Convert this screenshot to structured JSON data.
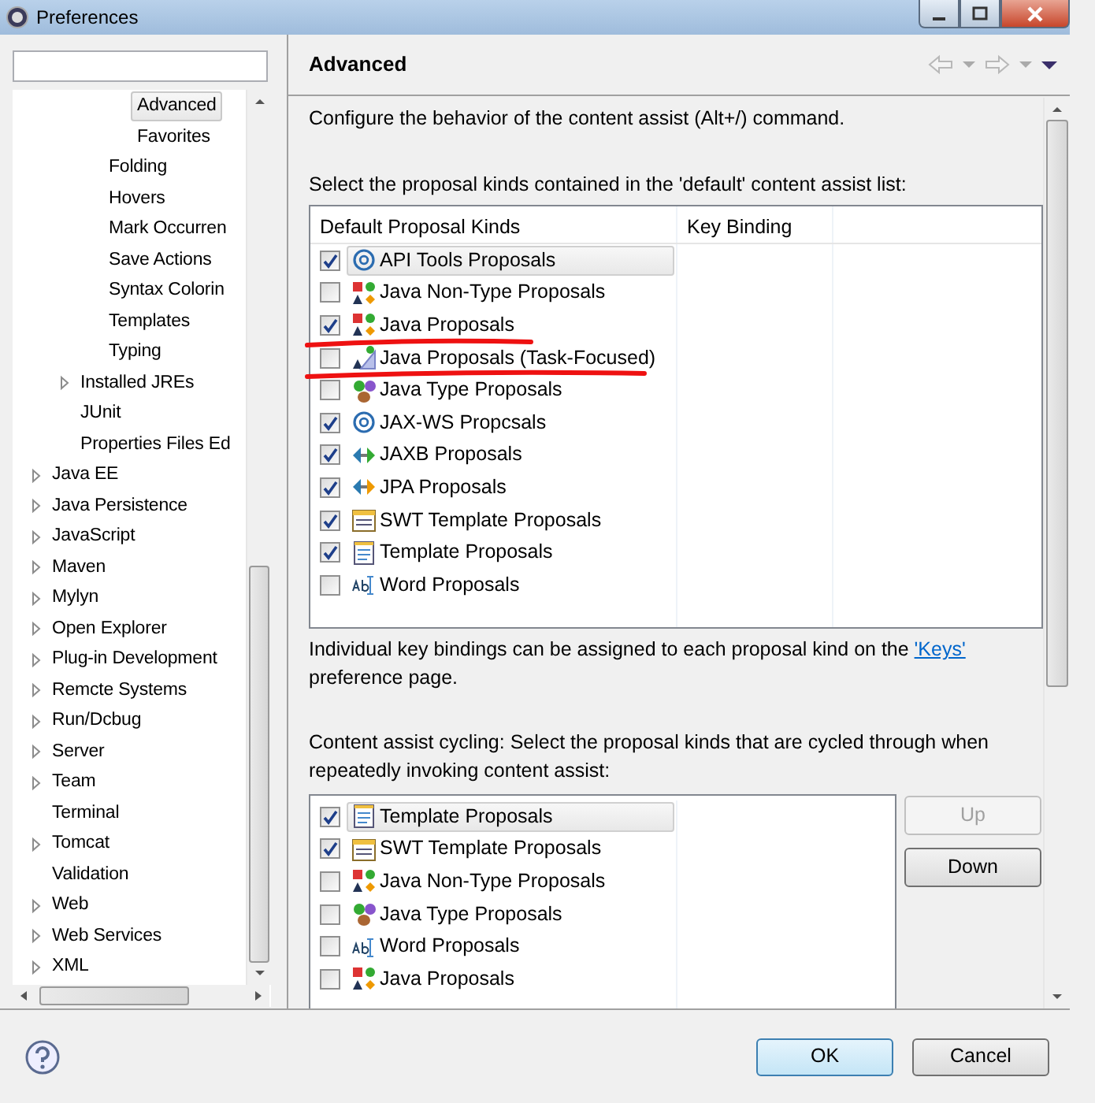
{
  "window": {
    "title": "Preferences"
  },
  "tree": [
    {
      "children": [
        {
          "children": [
            {
              "children": [
                {
                  "label": "Advanced",
                  "selected": true
                },
                {
                  "label": "Favorites",
                  "selected": false
                }
              ]
            },
            {
              "label": "Folding",
              "selected": false
            },
            {
              "label": "Hovers",
              "selected": false
            },
            {
              "label": "Mark Occurren",
              "selected": false
            },
            {
              "label": "Save Actions",
              "selected": false
            },
            {
              "label": "Syntax Colorin",
              "selected": false
            },
            {
              "label": "Templates",
              "selected": false
            },
            {
              "label": "Typing",
              "selected": false
            }
          ]
        },
        {
          "label": "Installed JREs",
          "selected": false,
          "expanded": false
        },
        {
          "label": "JUnit",
          "selected": false
        },
        {
          "label": "Properties Files Ed",
          "selected": false
        }
      ]
    },
    {
      "label": "Java EE",
      "selected": false,
      "expanded": false
    },
    {
      "label": "Java Persistence",
      "selected": false,
      "expanded": false
    },
    {
      "label": "JavaScript",
      "selected": false,
      "expanded": false
    },
    {
      "label": "Maven",
      "selected": false,
      "expanded": false
    },
    {
      "label": "Mylyn",
      "selected": false,
      "expanded": false
    },
    {
      "label": "Open Explorer",
      "selected": false,
      "expanded": false
    },
    {
      "label": "Plug-in Development",
      "selected": false,
      "expanded": false
    },
    {
      "label": "Remcte Systems",
      "selected": false,
      "expanded": false
    },
    {
      "label": "Run/Dcbug",
      "selected": false,
      "expanded": false
    },
    {
      "label": "Server",
      "selected": false,
      "expanded": false
    },
    {
      "label": "Team",
      "selected": false,
      "expanded": false
    },
    {
      "label": "Terminal",
      "selected": false
    },
    {
      "label": "Tomcat",
      "selected": false,
      "expanded": false
    },
    {
      "label": "Validation",
      "selected": false
    },
    {
      "label": "Web",
      "selected": false,
      "expanded": false
    },
    {
      "label": "Web Services",
      "selected": false,
      "expanded": false
    },
    {
      "label": "XML",
      "selected": false,
      "expanded": false
    }
  ],
  "page": {
    "title": "Advanced",
    "intro": "Configure the behavior of the content assist (Alt+/) command.",
    "default_label": "Select the proposal kinds contained in the 'default' content assist list:",
    "default_table": {
      "columns": [
        "Default Proposal Kinds",
        "Key Binding"
      ],
      "rows": [
        {
          "label": "API Tools Proposals",
          "kind": "at",
          "checked": true,
          "selected": true,
          "underlined": false
        },
        {
          "label": "Java Non-Type Proposals",
          "kind": "java",
          "checked": false,
          "selected": false,
          "underlined": false
        },
        {
          "label": "Java Proposals",
          "kind": "java",
          "checked": true,
          "selected": false,
          "underlined": true
        },
        {
          "label": "Java Proposals (Task-Focused)",
          "kind": "task",
          "checked": false,
          "selected": false,
          "underlined": true
        },
        {
          "label": "Java Type Proposals",
          "kind": "type",
          "checked": false,
          "selected": false,
          "underlined": false
        },
        {
          "label": "JAX-WS Propcsals",
          "kind": "at",
          "checked": true,
          "selected": false,
          "underlined": false
        },
        {
          "label": "JAXB Proposals",
          "kind": "jaxb",
          "checked": true,
          "selected": false,
          "underlined": false
        },
        {
          "label": "JPA Proposals",
          "kind": "jpa",
          "checked": true,
          "selected": false,
          "underlined": false
        },
        {
          "label": "SWT Template Proposals",
          "kind": "swt",
          "checked": true,
          "selected": false,
          "underlined": false
        },
        {
          "label": "Template Proposals",
          "kind": "template",
          "checked": true,
          "selected": false,
          "underlined": false
        },
        {
          "label": "Word Proposals",
          "kind": "word",
          "checked": false,
          "selected": false,
          "underlined": false
        }
      ]
    },
    "note": "Individual key bindings can be assigned to each proposal kind on the ",
    "note_link": "'Keys'",
    "note_end": "preference page.",
    "cycling_label": "Content assist cycling: Select the proposal kinds that are cycled through when repeatedly invoking content assist:",
    "cycling_list": [
      {
        "label": "Template Proposals",
        "kind": "template",
        "checked": true,
        "selected": true
      },
      {
        "label": "SWT Template Proposals",
        "kind": "swt",
        "checked": true,
        "selected": false
      },
      {
        "label": "Java Non-Type Proposals",
        "kind": "java",
        "checked": false,
        "selected": false
      },
      {
        "label": "Java Type Proposals",
        "kind": "type",
        "checked": false,
        "selected": false
      },
      {
        "label": "Word Proposals",
        "kind": "word",
        "checked": false,
        "selected": false
      },
      {
        "label": "Java Proposals",
        "kind": "java",
        "checked": false,
        "selected": false
      }
    ],
    "side_buttons": [
      {
        "label": "Up",
        "disabled": true
      },
      {
        "label": "Down",
        "disabled": false
      }
    ]
  },
  "buttons": [
    {
      "label": "OK",
      "default": true
    },
    {
      "label": "Cancel",
      "default": false
    }
  ]
}
